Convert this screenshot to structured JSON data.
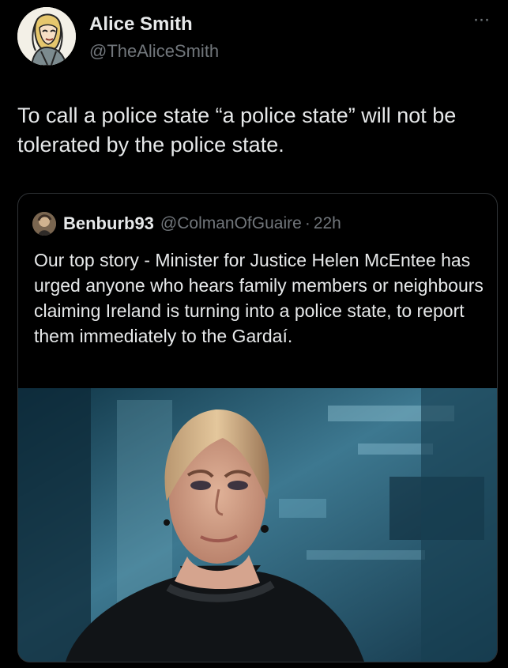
{
  "author": {
    "name": "Alice Smith",
    "handle": "@TheAliceSmith",
    "avatar_icon": "cartoon-woman-avatar"
  },
  "menu": {
    "more_icon": "more-horizontal-icon",
    "more_glyph": "···"
  },
  "tweet": {
    "text": "To call a police state “a police state” will not be tolerated by the police state."
  },
  "quote": {
    "author_name": "Benburb93",
    "author_handle": "@ColmanOfGuaire",
    "separator": "·",
    "time": "22h",
    "avatar_icon": "profile-photo-avatar",
    "text": "Our top story - Minister for Justice Helen McEntee has urged anyone who hears family members or neighbours  claiming Ireland is turning into a police state, to report them immediately to the Gardaí.",
    "image_icon": "news-presenter-photo"
  },
  "colors": {
    "background": "#000000",
    "primary_text": "#e7e9ea",
    "secondary_text": "#71767b",
    "border": "#2f3336"
  }
}
